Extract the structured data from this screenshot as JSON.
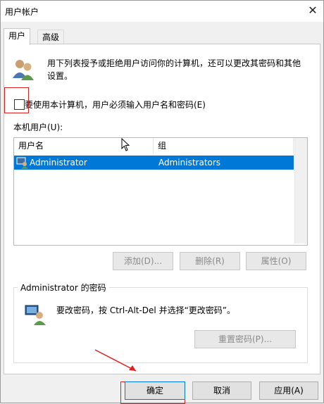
{
  "window": {
    "title": "用户帐户",
    "close_glyph": "✕"
  },
  "tabs": [
    {
      "label": "用户"
    },
    {
      "label": "高级"
    }
  ],
  "intro_text_line1": "用下列表授予或拒绝用户访问你的计算机，还可以更改其密码和其他",
  "intro_text_line2": "设置。",
  "require_login_checkbox": {
    "label": "要使用本计算机，用户必须输入用户名和密码(E)",
    "checked": false
  },
  "users_label": "本机用户(U):",
  "users_table": {
    "columns": [
      "用户名",
      "组"
    ],
    "rows": [
      {
        "username": "Administrator",
        "group": "Administrators"
      }
    ]
  },
  "user_buttons": {
    "add": "添加(D)...",
    "remove": "删除(R)",
    "properties": "属性(O)"
  },
  "password_group": {
    "title": "Administrator 的密码",
    "instruction": "要改密码，按 Ctrl-Alt-Del 并选择“更改密码”。",
    "reset_button": "重置密码(P)..."
  },
  "dialog_buttons": {
    "ok": "确定",
    "cancel": "取消",
    "apply": "应用(A)"
  },
  "colors": {
    "selection": "#0078d7",
    "annotation": "#e02020"
  },
  "icons": [
    "users-icon",
    "user-row-icon",
    "keyboard-user-icon",
    "close-icon",
    "cursor-icon"
  ]
}
